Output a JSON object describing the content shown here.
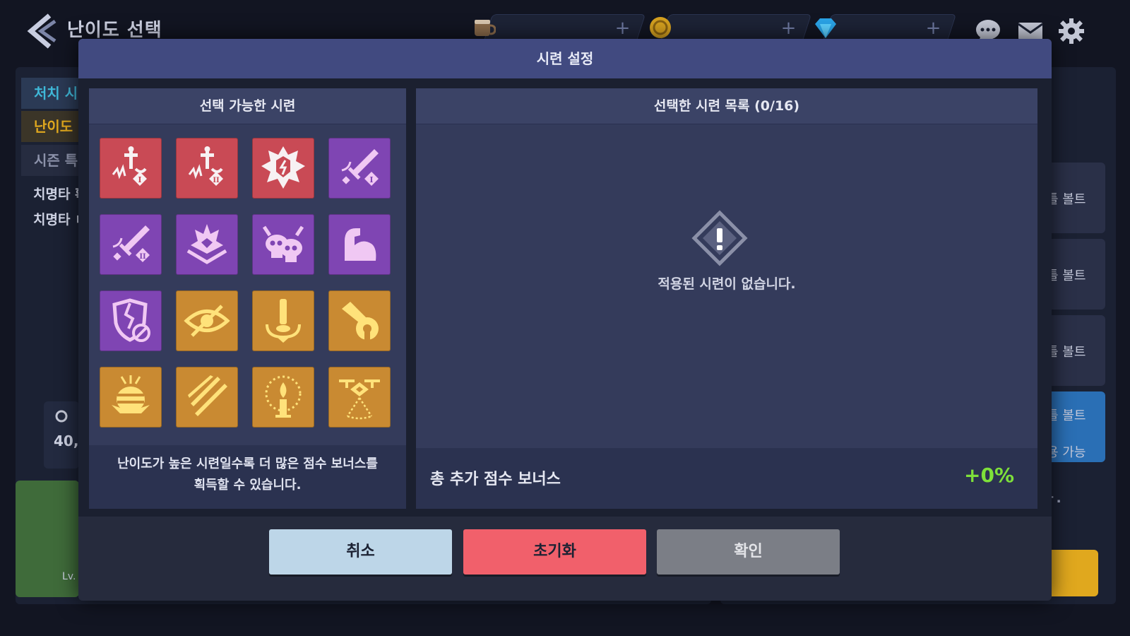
{
  "header": {
    "title": "난이도 선택",
    "currencies": [
      {
        "icon": "coffee-icon",
        "value": ""
      },
      {
        "icon": "gold-coin-icon",
        "value": ""
      },
      {
        "icon": "blue-gem-icon",
        "value": ""
      }
    ],
    "plus_label": "+"
  },
  "background": {
    "tabs": [
      "처치 시",
      "난이도",
      "시즌 특"
    ],
    "lines": [
      "치명타 확",
      "치명타 ㅂ"
    ],
    "stat_value": "40,",
    "level_label": "Lv.",
    "side_items": [
      "틀 볼트",
      "틀 볼트",
      "틀 볼트",
      "틀 볼트"
    ],
    "side_sub": "용 가능",
    "side_note": "ㅏ."
  },
  "modal": {
    "title": "시련 설정",
    "available": {
      "title": "선택 가능한 시련",
      "tiles": [
        {
          "color": "red",
          "icon": "sword-break-tier1-icon"
        },
        {
          "color": "red",
          "icon": "sword-break-tier2-icon"
        },
        {
          "color": "red",
          "icon": "explosion-badge-icon"
        },
        {
          "color": "purple",
          "icon": "sword-tier1-icon"
        },
        {
          "color": "purple",
          "icon": "sword-tier2-icon"
        },
        {
          "color": "purple",
          "icon": "crown-aura-icon"
        },
        {
          "color": "purple",
          "icon": "twin-skulls-icon"
        },
        {
          "color": "purple",
          "icon": "flexed-arm-icon"
        },
        {
          "color": "purple",
          "icon": "broken-shield-icon"
        },
        {
          "color": "gold",
          "icon": "blind-eye-icon"
        },
        {
          "color": "gold",
          "icon": "pillar-impact-icon"
        },
        {
          "color": "gold",
          "icon": "cannon-icon"
        },
        {
          "color": "gold",
          "icon": "bee-hive-icon"
        },
        {
          "color": "gold",
          "icon": "claw-slash-icon"
        },
        {
          "color": "gold",
          "icon": "candle-icon"
        },
        {
          "color": "gold",
          "icon": "drone-icon"
        }
      ],
      "note_line1": "난이도가 높은 시련일수록 더 많은 점수 보너스를",
      "note_line2": "획득할 수 있습니다."
    },
    "selected": {
      "title": "선택한 시련 목록 (0/16)",
      "empty_text": "적용된 시련이 없습니다.",
      "bonus_label": "총 추가 점수 보너스",
      "bonus_value": "+0%"
    },
    "buttons": {
      "cancel": "취소",
      "reset": "초기화",
      "confirm": "확인"
    }
  },
  "colors": {
    "red": "#c94a55",
    "purple": "#7f45b3",
    "gold": "#c98a32",
    "header": "#414a80",
    "bonus_green": "#7ee03a"
  }
}
